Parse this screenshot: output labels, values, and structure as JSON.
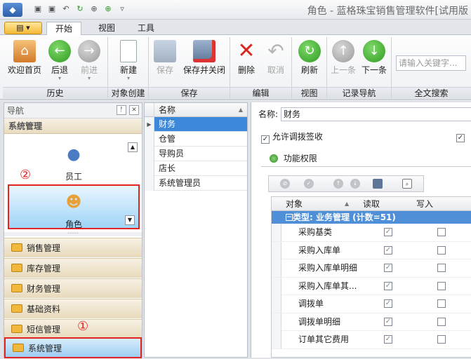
{
  "window": {
    "title": "角色 - 蓝格珠宝销售管理软件[试用版"
  },
  "ribbon": {
    "tabs": [
      "开始",
      "视图",
      "工具"
    ],
    "groups": {
      "history": "历史",
      "object_create": "对象创建",
      "save": "保存",
      "edit": "编辑",
      "view": "视图",
      "record_nav": "记录导航",
      "fulltext": "全文搜索"
    },
    "buttons": {
      "home": "欢迎首页",
      "back": "后退",
      "forward": "前进",
      "new": "新建",
      "save": "保存",
      "save_close": "保存并关闭",
      "delete": "删除",
      "cancel": "取消",
      "refresh": "刷新",
      "prev": "上一条",
      "next": "下一条"
    },
    "search_placeholder": "请输入关键字..."
  },
  "nav": {
    "title": "导航",
    "group_title": "系统管理",
    "items": [
      {
        "label": "员工",
        "icon": "user-icon"
      },
      {
        "label": "角色",
        "icon": "role-icon"
      }
    ],
    "annotations": [
      "②",
      "①"
    ],
    "categories": [
      "销售管理",
      "库存管理",
      "财务管理",
      "基础资料",
      "短信管理",
      "系统管理"
    ],
    "active_category": "系统管理"
  },
  "list": {
    "header": "名称",
    "rows": [
      "财务",
      "仓管",
      "导购员",
      "店长",
      "系统管理员"
    ],
    "selected": "财务"
  },
  "detail": {
    "name_label": "名称:",
    "name_value": "财务",
    "allow_transfer_label": "允许调拨签收",
    "allow_transfer_checked": true,
    "perm_tab": "功能权限",
    "grid": {
      "columns": [
        "对象",
        "读取",
        "写入"
      ],
      "group_label": "类型: 业务管理 (计数=51)",
      "rows": [
        {
          "object": "采购基类",
          "read": true,
          "write": false
        },
        {
          "object": "采购入库单",
          "read": true,
          "write": false
        },
        {
          "object": "采购入库单明细",
          "read": true,
          "write": false
        },
        {
          "object": "采购入库单其...",
          "read": true,
          "write": false
        },
        {
          "object": "调拨单",
          "read": true,
          "write": false
        },
        {
          "object": "调拨单明细",
          "read": true,
          "write": false
        },
        {
          "object": "订单其它费用",
          "read": true,
          "write": false
        }
      ]
    }
  }
}
